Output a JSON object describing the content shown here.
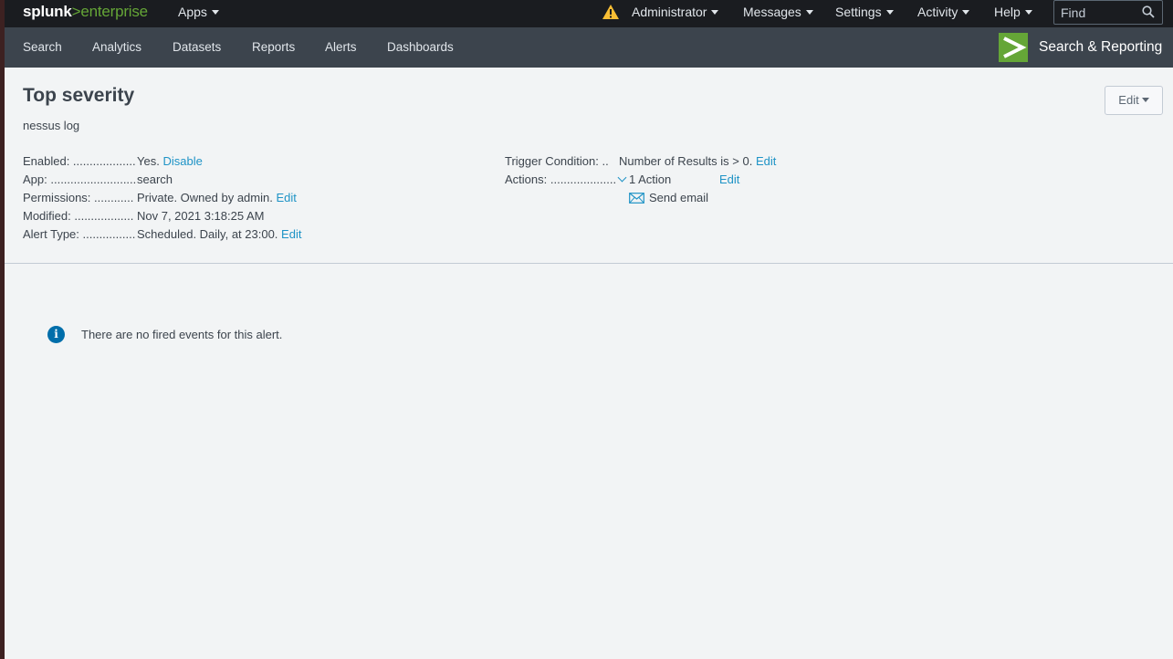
{
  "topbar": {
    "logo_brand": "splunk",
    "logo_gt": ">",
    "logo_product": "enterprise",
    "apps": "Apps",
    "user": "Administrator",
    "messages": "Messages",
    "settings": "Settings",
    "activity": "Activity",
    "help": "Help",
    "find_placeholder": "Find",
    "warning_icon": "warning-triangle-icon",
    "accent_color": "#65a637"
  },
  "appbar": {
    "nav": [
      "Search",
      "Analytics",
      "Datasets",
      "Reports",
      "Alerts",
      "Dashboards"
    ],
    "app_title": "Search & Reporting"
  },
  "alert": {
    "title": "Top severity",
    "description": "nessus log",
    "edit_button": "Edit",
    "enabled_label": "Enabled: ...................",
    "enabled_value": "Yes.",
    "enabled_link": "Disable",
    "app_label": "App: ..........................",
    "app_value": "search",
    "permissions_label": "Permissions: ............",
    "permissions_value": "Private. Owned by admin.",
    "permissions_link": "Edit",
    "modified_label": "Modified: ..................",
    "modified_value": "Nov 7, 2021 3:18:25 AM",
    "alert_type_label": "Alert Type: ................",
    "alert_type_value": "Scheduled. Daily, at 23:00.",
    "alert_type_link": "Edit",
    "trigger_label": "Trigger Condition: ..",
    "trigger_value": "Number of Results is > 0.",
    "trigger_link": "Edit",
    "actions_label": "Actions: ....................",
    "actions_value": "1 Action",
    "actions_link": "Edit",
    "action_item": "Send email"
  },
  "fired_events": {
    "message": "There are no fired events for this alert."
  }
}
